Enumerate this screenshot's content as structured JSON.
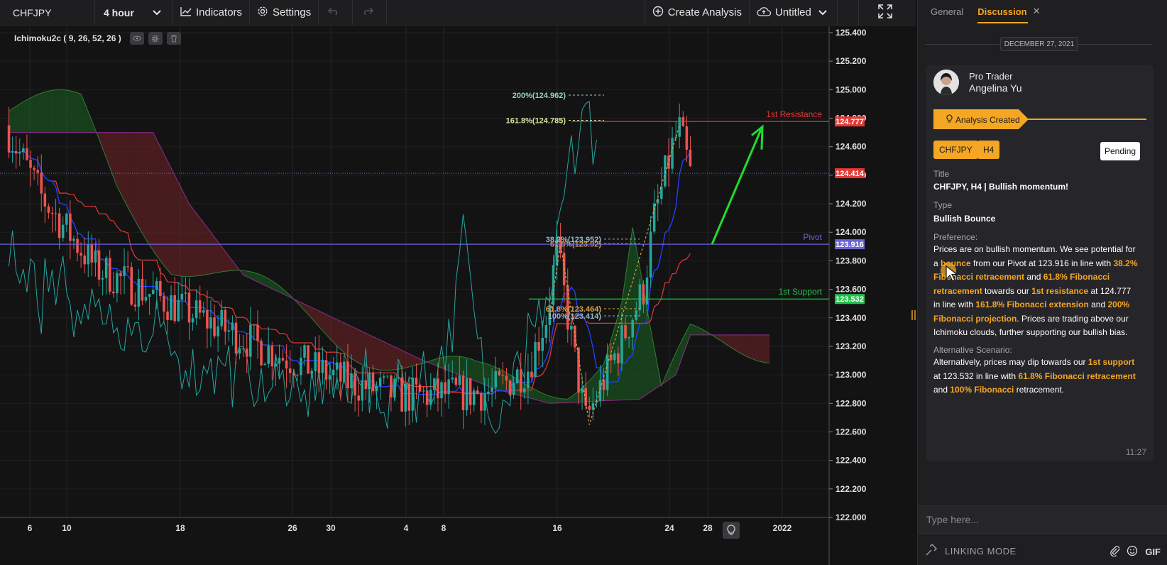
{
  "toolbar": {
    "symbol": "CHFJPY",
    "interval": "4 hour",
    "indicators_label": "Indicators",
    "settings_label": "Settings",
    "create_analysis_label": "Create Analysis",
    "layout_name": "Untitled"
  },
  "indicator": {
    "legend": "Ichimoku2c ( 9, 26, 52, 26 )"
  },
  "chart_data": {
    "type": "candlestick",
    "symbol": "CHFJPY",
    "interval": "4 hour",
    "y_axis": {
      "range": [
        122.0,
        125.4
      ],
      "tick_labels": [
        "125.400",
        "125.200",
        "125.000",
        "124.800",
        "124.600",
        "124.400",
        "124.200",
        "124.000",
        "123.800",
        "123.600",
        "123.400",
        "123.200",
        "123.000",
        "122.800",
        "122.600",
        "122.400",
        "122.200",
        "122.000"
      ]
    },
    "x_axis": {
      "tick_labels": [
        "6",
        "10",
        "18",
        "26",
        "30",
        "4",
        "8",
        "16",
        "24",
        "28",
        "2022"
      ]
    },
    "horizontal_levels": [
      {
        "name": "1st Resistance",
        "value": 124.777,
        "value_label": "124.777",
        "color": "#e53935"
      },
      {
        "name": "Pivot",
        "value": 123.916,
        "value_label": "123.916",
        "color": "#6b63d6"
      },
      {
        "name": "1st Support",
        "value": 123.532,
        "value_label": "123.532",
        "color": "#21c24b"
      }
    ],
    "current_price": {
      "value": 124.414,
      "value_label": "124.414",
      "color": "#e53935"
    },
    "fibonacci_labels": [
      {
        "text": "200%(124.962)",
        "value": 124.962,
        "color": "#8fd3c8"
      },
      {
        "text": "161.8%(124.785)",
        "value": 124.785,
        "color": "#d8e29a"
      },
      {
        "text": "38.2%(123.952)",
        "value": 123.952,
        "color": "#9ab6c8"
      },
      {
        "text": "61.8%(123.92)",
        "value": 123.92,
        "color": "#d8a04a"
      },
      {
        "text": "61.8%(123.464)",
        "value": 123.464,
        "color": "#d8a04a"
      },
      {
        "text": "100%(123.414)",
        "value": 123.414,
        "color": "#9ab6c8"
      }
    ],
    "colors": {
      "bull": "#26a69a",
      "bear": "#ef5350",
      "tenkan": "#1e40ff",
      "kijun": "#e53935",
      "chikou": "#22a6a0",
      "cloud_bull": "#1b5e20",
      "cloud_bear": "#6d2325"
    }
  },
  "panel": {
    "tabs": [
      "General",
      "Discussion"
    ],
    "active_tab": "Discussion",
    "date": "DECEMBER 27, 2021",
    "author_role": "Pro Trader",
    "author_name": "Angelina Yu",
    "banner": "Analysis Created",
    "tag_symbol": "CHFJPY",
    "tag_interval": "H4",
    "status": "Pending",
    "title_label": "Title",
    "title_value": "CHFJPY, H4 | Bullish momentum!",
    "type_label": "Type",
    "type_value": "Bullish Bounce",
    "preference_label": "Preference:",
    "alternative_label": "Alternative Scenario:",
    "time": "11:27",
    "compose_placeholder": "Type here...",
    "linking_mode": "LINKING MODE",
    "gif_label": "GIF"
  },
  "preference": [
    {
      "t": "Prices are on bullish momentum. We see potential for a "
    },
    {
      "t": "bounce",
      "h": true
    },
    {
      "t": " from our Pivot at 123.916 in line with "
    },
    {
      "t": "38.2% Fibonacci retracement",
      "h": true
    },
    {
      "t": " and "
    },
    {
      "t": "61.8% Fibonacci retracement",
      "h": true
    },
    {
      "t": " towards our "
    },
    {
      "t": "1st resistance",
      "h": true
    },
    {
      "t": " at 124.777 in line with "
    },
    {
      "t": "161.8% Fibonacci extension",
      "h": true
    },
    {
      "t": " and "
    },
    {
      "t": "200% Fibonacci projection",
      "h": true
    },
    {
      "t": ". Prices are trading above our Ichimoku clouds, further supporting our bullish bias."
    }
  ],
  "alternative": [
    {
      "t": "Alternatively, prices may dip towards our "
    },
    {
      "t": "1st support",
      "h": true
    },
    {
      "t": " at 123.532 in line with "
    },
    {
      "t": "61.8% Fibonacci retracement",
      "h": true
    },
    {
      "t": " and "
    },
    {
      "t": "100% Fibonacci",
      "h": true
    },
    {
      "t": " retracement."
    }
  ]
}
